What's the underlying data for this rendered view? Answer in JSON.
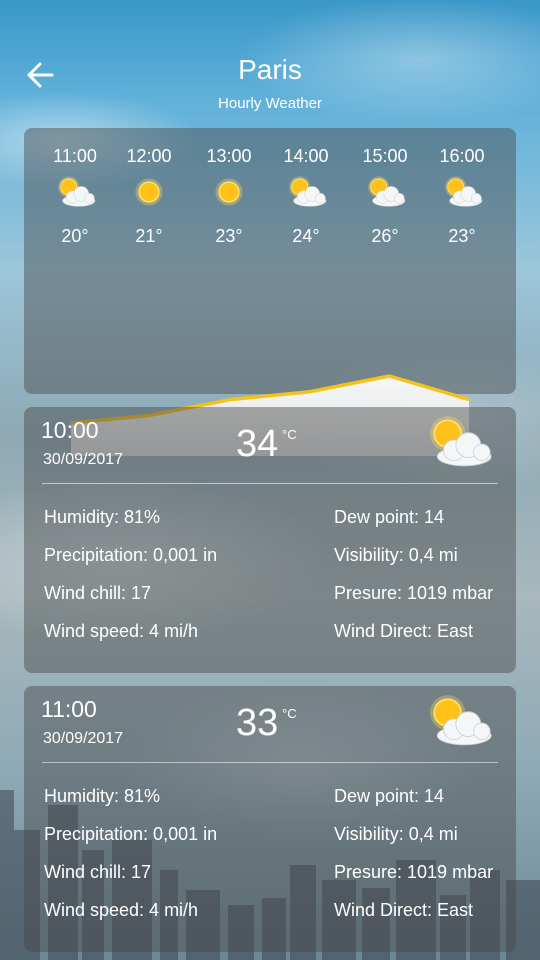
{
  "header": {
    "city": "Paris",
    "subtitle": "Hourly Weather",
    "back_icon": "arrow-left-icon"
  },
  "hourly": [
    {
      "time": "11:00",
      "temp": "20°",
      "icon": "partly-cloudy-icon"
    },
    {
      "time": "12:00",
      "temp": "21°",
      "icon": "sunny-icon"
    },
    {
      "time": "13:00",
      "temp": "23°",
      "icon": "sunny-icon"
    },
    {
      "time": "14:00",
      "temp": "24°",
      "icon": "partly-cloudy-icon"
    },
    {
      "time": "15:00",
      "temp": "26°",
      "icon": "partly-cloudy-icon"
    },
    {
      "time": "16:00",
      "temp": "23°",
      "icon": "partly-cloudy-icon"
    }
  ],
  "chart_data": {
    "type": "area",
    "x": [
      "11:00",
      "12:00",
      "13:00",
      "14:00",
      "15:00",
      "16:00"
    ],
    "values": [
      20,
      21,
      23,
      24,
      26,
      23
    ]
  },
  "details": [
    {
      "time": "10:00",
      "date": "30/09/2017",
      "temp": "34",
      "unit": "°C",
      "icon": "partly-cloudy-icon",
      "humidity": "Humidity: 81%",
      "precipitation": "Precipitation: 0,001 in",
      "wind_chill": "Wind chill: 17",
      "wind_speed": "Wind speed: 4 mi/h",
      "dew_point": "Dew point: 14",
      "visibility": "Visibility: 0,4 mi",
      "pressure": "Presure: 1019 mbar",
      "wind_direction": "Wind Direct: East"
    },
    {
      "time": "11:00",
      "date": "30/09/2017",
      "temp": "33",
      "unit": "°C",
      "icon": "partly-cloudy-icon",
      "humidity": "Humidity: 81%",
      "precipitation": "Precipitation: 0,001 in",
      "wind_chill": "Wind chill: 17",
      "wind_speed": "Wind speed: 4 mi/h",
      "dew_point": "Dew point: 14",
      "visibility": "Visibility: 0,4 mi",
      "pressure": "Presure: 1019 mbar",
      "wind_direction": "Wind Direct: East"
    }
  ],
  "colors": {
    "accent_line": "#f2c41a",
    "sun": "#ffc21a"
  }
}
